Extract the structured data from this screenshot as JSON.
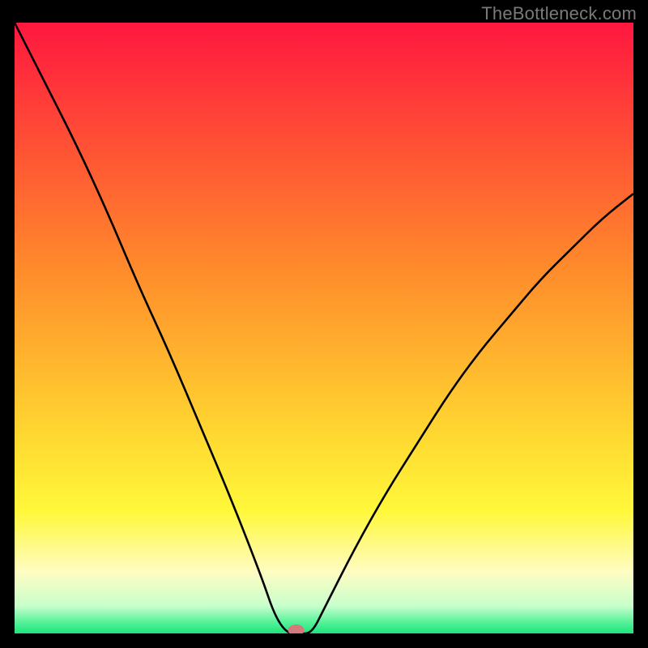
{
  "watermark": "TheBottleneck.com",
  "chart_data": {
    "type": "line",
    "title": "",
    "xlabel": "",
    "ylabel": "",
    "xlim": [
      0,
      100
    ],
    "ylim": [
      0,
      100
    ],
    "x": [
      0,
      5,
      10,
      15,
      20,
      25,
      30,
      35,
      40,
      42,
      44,
      46,
      48,
      50,
      55,
      60,
      65,
      70,
      75,
      80,
      85,
      90,
      95,
      100
    ],
    "values": [
      100,
      90,
      80,
      69,
      57,
      46,
      34,
      22,
      9,
      3,
      0,
      0,
      0,
      4,
      14,
      23,
      31,
      39,
      46,
      52,
      58,
      63,
      68,
      72
    ],
    "marker": {
      "x": 45.5,
      "y": 0
    },
    "gradient_bands": [
      {
        "stop": 0.0,
        "color": "#ff173f"
      },
      {
        "stop": 0.4,
        "color": "#ff8a2b"
      },
      {
        "stop": 0.68,
        "color": "#ffd931"
      },
      {
        "stop": 0.8,
        "color": "#fff83a"
      },
      {
        "stop": 0.9,
        "color": "#fffcc3"
      },
      {
        "stop": 0.955,
        "color": "#c8ffcc"
      },
      {
        "stop": 0.98,
        "color": "#5cf29c"
      },
      {
        "stop": 1.0,
        "color": "#1de57d"
      }
    ]
  }
}
